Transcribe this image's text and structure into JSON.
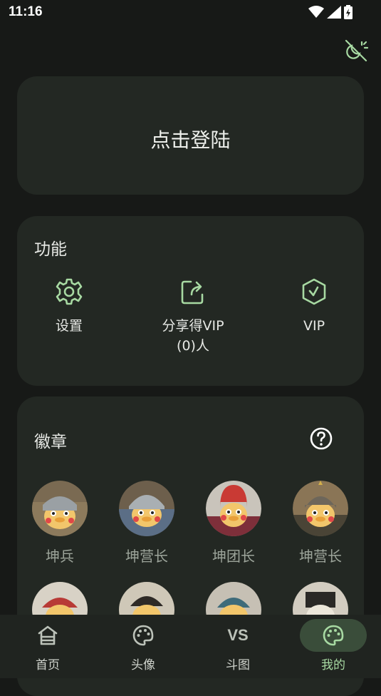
{
  "status_bar": {
    "time": "11:16"
  },
  "login": {
    "label": "点击登陆"
  },
  "functions": {
    "title": "功能",
    "items": [
      {
        "label": "设置",
        "icon": "gear-icon"
      },
      {
        "label": "分享得VIP",
        "sublabel": "(0)人",
        "icon": "share-icon"
      },
      {
        "label": "VIP",
        "icon": "vip-hexagon-icon"
      }
    ]
  },
  "badges": {
    "title": "徽章",
    "help_icon": "help-circle-icon",
    "items": [
      {
        "label": "坤兵"
      },
      {
        "label": "坤营长"
      },
      {
        "label": "坤团长"
      },
      {
        "label": "坤营长"
      }
    ]
  },
  "nav": {
    "items": [
      {
        "label": "首页",
        "icon": "home-icon"
      },
      {
        "label": "头像",
        "icon": "palette-icon"
      },
      {
        "label": "斗图",
        "icon_text": "VS"
      },
      {
        "label": "我的",
        "icon": "palette-icon",
        "active": true
      }
    ]
  },
  "colors": {
    "background": "#171917",
    "card": "#232823",
    "accent": "#a7d9a2",
    "nav_active": "#3a4d3a"
  }
}
